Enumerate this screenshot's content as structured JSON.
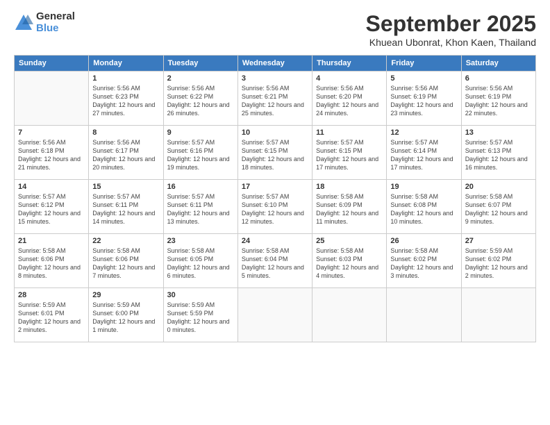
{
  "logo": {
    "general": "General",
    "blue": "Blue"
  },
  "header": {
    "month": "September 2025",
    "location": "Khuean Ubonrat, Khon Kaen, Thailand"
  },
  "weekdays": [
    "Sunday",
    "Monday",
    "Tuesday",
    "Wednesday",
    "Thursday",
    "Friday",
    "Saturday"
  ],
  "weeks": [
    [
      {
        "day": "",
        "empty": true
      },
      {
        "day": "1",
        "sunrise": "5:56 AM",
        "sunset": "6:23 PM",
        "daylight": "12 hours and 27 minutes."
      },
      {
        "day": "2",
        "sunrise": "5:56 AM",
        "sunset": "6:22 PM",
        "daylight": "12 hours and 26 minutes."
      },
      {
        "day": "3",
        "sunrise": "5:56 AM",
        "sunset": "6:21 PM",
        "daylight": "12 hours and 25 minutes."
      },
      {
        "day": "4",
        "sunrise": "5:56 AM",
        "sunset": "6:20 PM",
        "daylight": "12 hours and 24 minutes."
      },
      {
        "day": "5",
        "sunrise": "5:56 AM",
        "sunset": "6:19 PM",
        "daylight": "12 hours and 23 minutes."
      },
      {
        "day": "6",
        "sunrise": "5:56 AM",
        "sunset": "6:19 PM",
        "daylight": "12 hours and 22 minutes."
      }
    ],
    [
      {
        "day": "7",
        "sunrise": "5:56 AM",
        "sunset": "6:18 PM",
        "daylight": "12 hours and 21 minutes."
      },
      {
        "day": "8",
        "sunrise": "5:56 AM",
        "sunset": "6:17 PM",
        "daylight": "12 hours and 20 minutes."
      },
      {
        "day": "9",
        "sunrise": "5:57 AM",
        "sunset": "6:16 PM",
        "daylight": "12 hours and 19 minutes."
      },
      {
        "day": "10",
        "sunrise": "5:57 AM",
        "sunset": "6:15 PM",
        "daylight": "12 hours and 18 minutes."
      },
      {
        "day": "11",
        "sunrise": "5:57 AM",
        "sunset": "6:15 PM",
        "daylight": "12 hours and 17 minutes."
      },
      {
        "day": "12",
        "sunrise": "5:57 AM",
        "sunset": "6:14 PM",
        "daylight": "12 hours and 17 minutes."
      },
      {
        "day": "13",
        "sunrise": "5:57 AM",
        "sunset": "6:13 PM",
        "daylight": "12 hours and 16 minutes."
      }
    ],
    [
      {
        "day": "14",
        "sunrise": "5:57 AM",
        "sunset": "6:12 PM",
        "daylight": "12 hours and 15 minutes."
      },
      {
        "day": "15",
        "sunrise": "5:57 AM",
        "sunset": "6:11 PM",
        "daylight": "12 hours and 14 minutes."
      },
      {
        "day": "16",
        "sunrise": "5:57 AM",
        "sunset": "6:11 PM",
        "daylight": "12 hours and 13 minutes."
      },
      {
        "day": "17",
        "sunrise": "5:57 AM",
        "sunset": "6:10 PM",
        "daylight": "12 hours and 12 minutes."
      },
      {
        "day": "18",
        "sunrise": "5:58 AM",
        "sunset": "6:09 PM",
        "daylight": "12 hours and 11 minutes."
      },
      {
        "day": "19",
        "sunrise": "5:58 AM",
        "sunset": "6:08 PM",
        "daylight": "12 hours and 10 minutes."
      },
      {
        "day": "20",
        "sunrise": "5:58 AM",
        "sunset": "6:07 PM",
        "daylight": "12 hours and 9 minutes."
      }
    ],
    [
      {
        "day": "21",
        "sunrise": "5:58 AM",
        "sunset": "6:06 PM",
        "daylight": "12 hours and 8 minutes."
      },
      {
        "day": "22",
        "sunrise": "5:58 AM",
        "sunset": "6:06 PM",
        "daylight": "12 hours and 7 minutes."
      },
      {
        "day": "23",
        "sunrise": "5:58 AM",
        "sunset": "6:05 PM",
        "daylight": "12 hours and 6 minutes."
      },
      {
        "day": "24",
        "sunrise": "5:58 AM",
        "sunset": "6:04 PM",
        "daylight": "12 hours and 5 minutes."
      },
      {
        "day": "25",
        "sunrise": "5:58 AM",
        "sunset": "6:03 PM",
        "daylight": "12 hours and 4 minutes."
      },
      {
        "day": "26",
        "sunrise": "5:58 AM",
        "sunset": "6:02 PM",
        "daylight": "12 hours and 3 minutes."
      },
      {
        "day": "27",
        "sunrise": "5:59 AM",
        "sunset": "6:02 PM",
        "daylight": "12 hours and 2 minutes."
      }
    ],
    [
      {
        "day": "28",
        "sunrise": "5:59 AM",
        "sunset": "6:01 PM",
        "daylight": "12 hours and 2 minutes."
      },
      {
        "day": "29",
        "sunrise": "5:59 AM",
        "sunset": "6:00 PM",
        "daylight": "12 hours and 1 minute."
      },
      {
        "day": "30",
        "sunrise": "5:59 AM",
        "sunset": "5:59 PM",
        "daylight": "12 hours and 0 minutes."
      },
      {
        "day": "",
        "empty": true
      },
      {
        "day": "",
        "empty": true
      },
      {
        "day": "",
        "empty": true
      },
      {
        "day": "",
        "empty": true
      }
    ]
  ]
}
